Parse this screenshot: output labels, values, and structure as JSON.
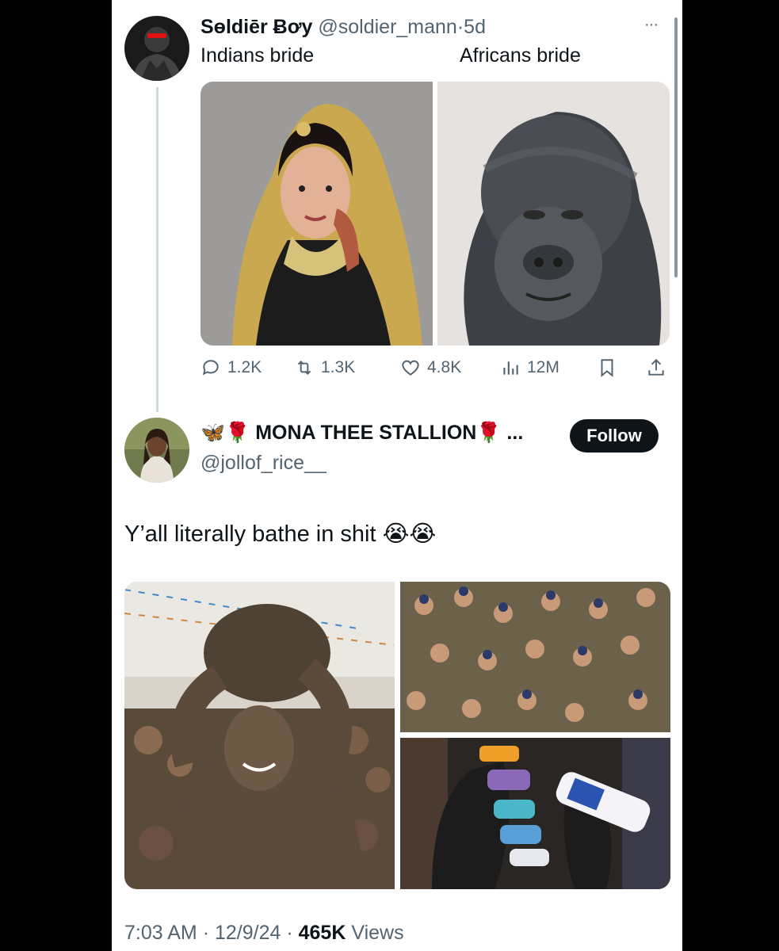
{
  "parent_tweet": {
    "display_name": "Sɵldiēr Ƀơy",
    "handle": "@soldier_mann",
    "separator": "·",
    "time_ago": "5d",
    "more_label": "···",
    "caption_left": "Indians bride",
    "caption_right": "Africans bride",
    "media": [
      {
        "icon": "bride-photo"
      },
      {
        "icon": "gorilla-photo"
      }
    ],
    "stats": {
      "replies": "1.2K",
      "retweets": "1.3K",
      "likes": "4.8K",
      "views": "12M"
    }
  },
  "reply_tweet": {
    "display_name": "🦋🌹 MONA THEE STALLION🌹 ...",
    "handle": "@jollof_rice__",
    "follow_label": "Follow",
    "text": "Y’all literally bathe in shit 😭😭",
    "media": [
      {
        "icon": "mud-covered-man-photo"
      },
      {
        "icon": "mud-pit-crowd-photo"
      },
      {
        "icon": "hands-holding-soap-photo"
      }
    ],
    "meta": {
      "time": "7:03 AM",
      "sep1": "·",
      "date": "12/9/24",
      "sep2": "·",
      "views_count": "465K",
      "views_label": "Views"
    }
  },
  "colors": {
    "text": "#0f1419",
    "muted": "#536471",
    "thread_line": "#cfd9de",
    "follow_bg": "#0f1419"
  }
}
